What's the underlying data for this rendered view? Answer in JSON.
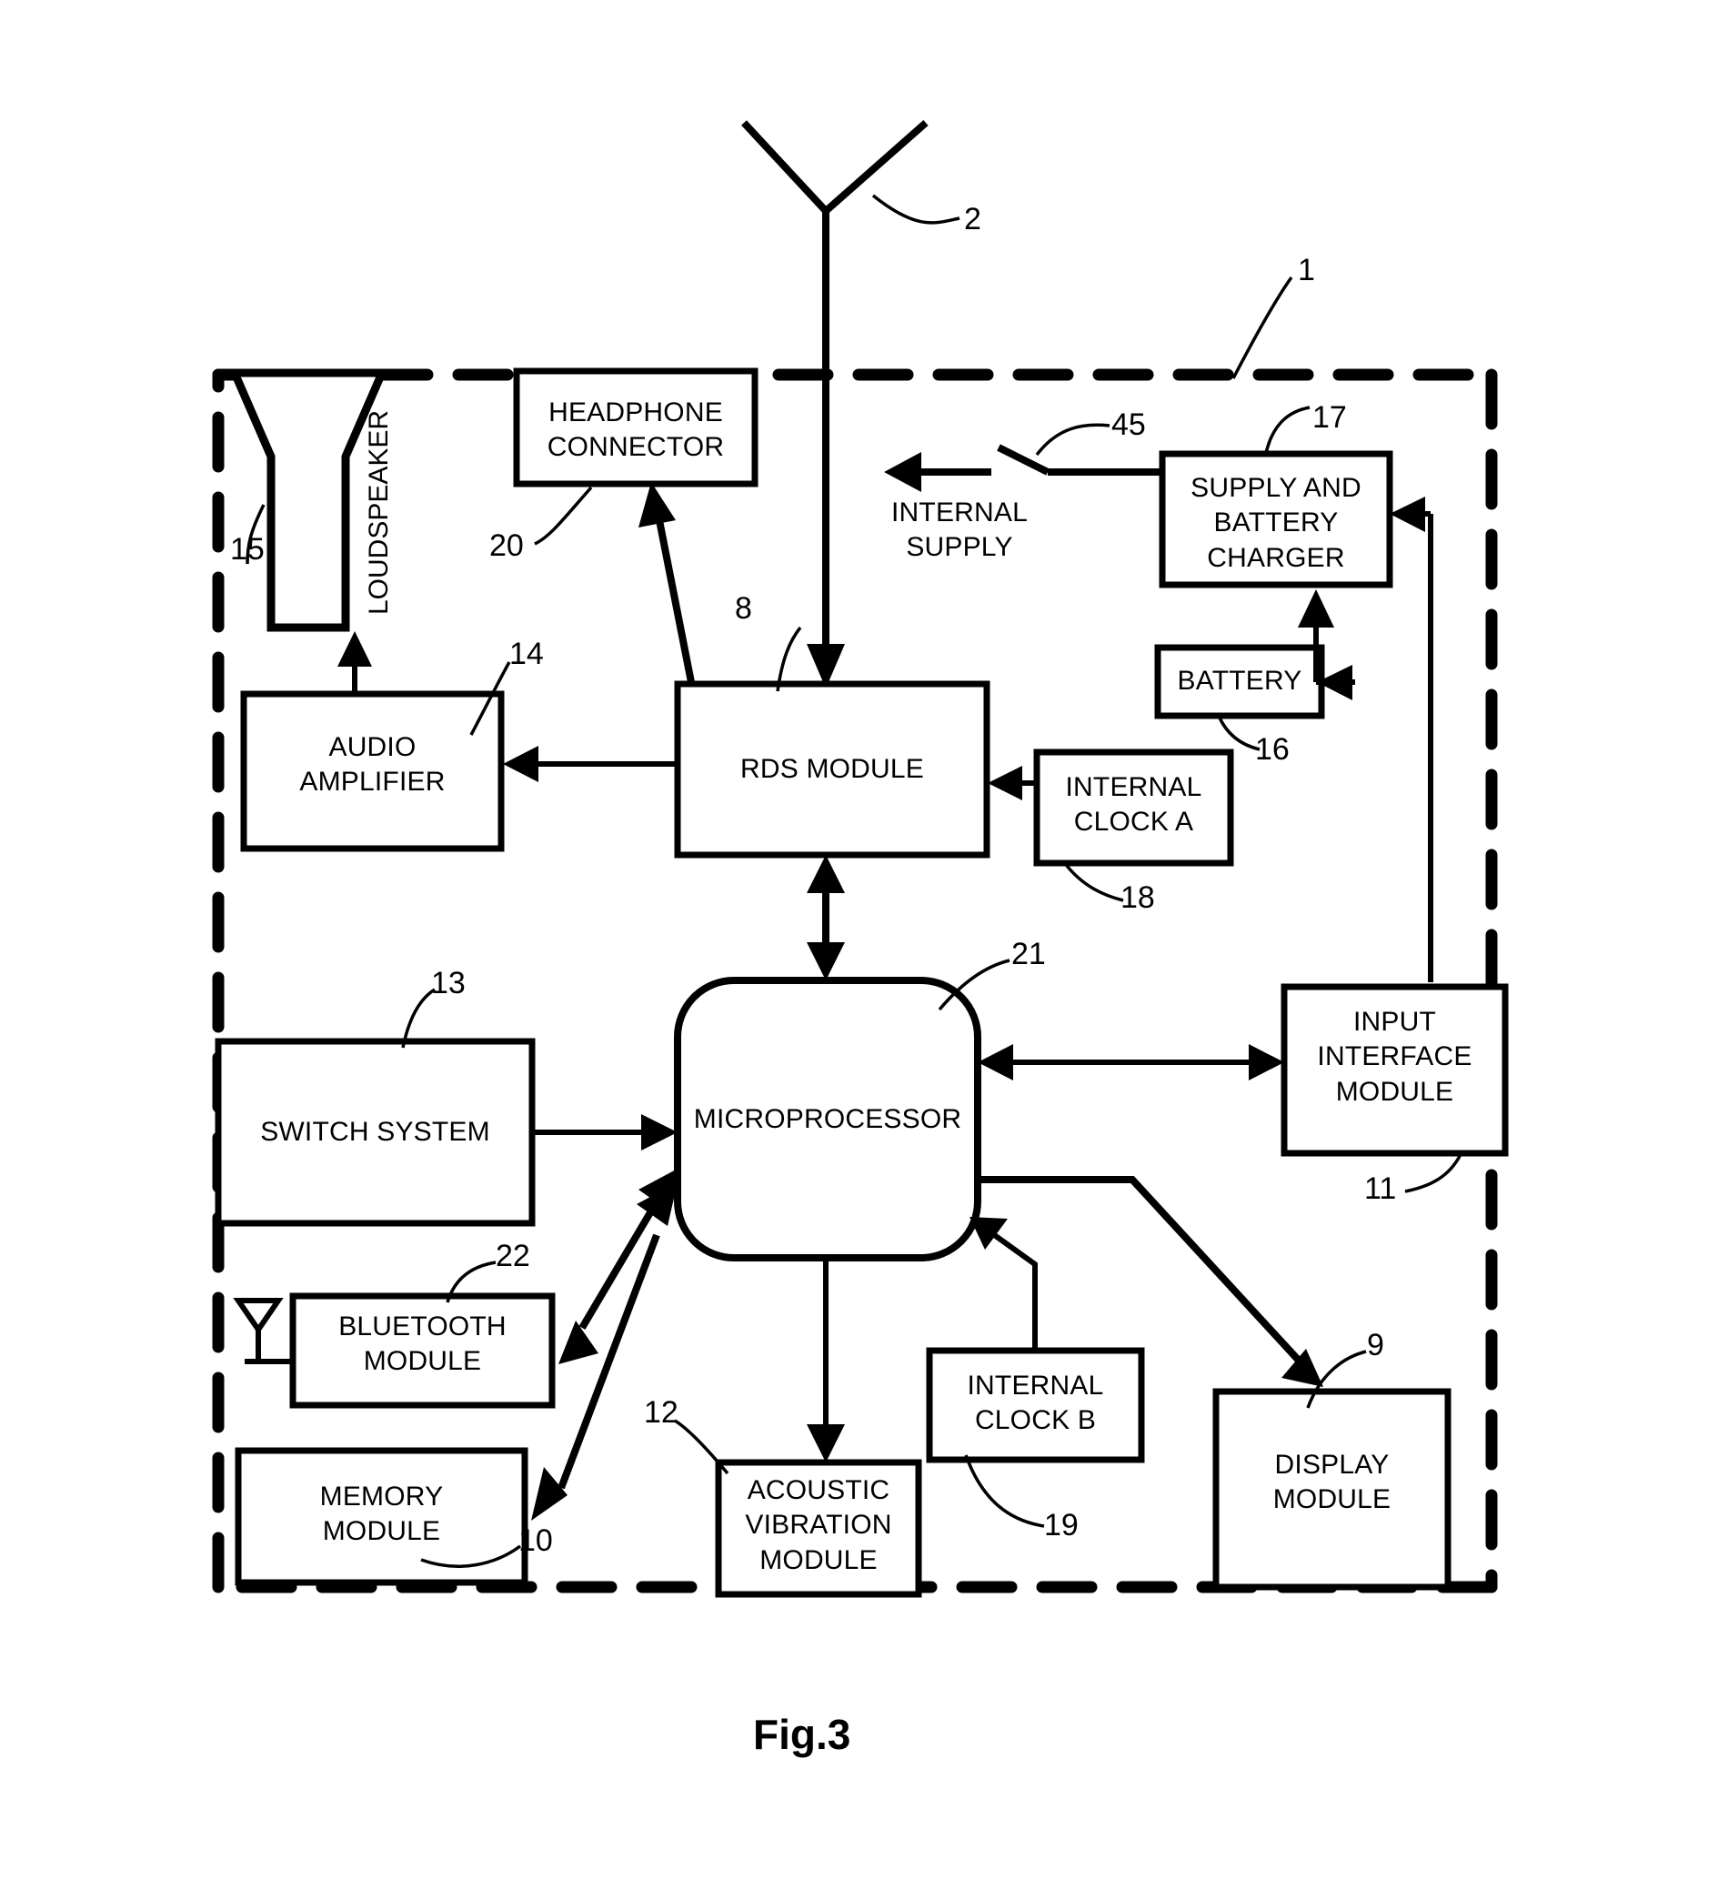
{
  "figure": {
    "caption": "Fig.3",
    "enclosure_ref": "1"
  },
  "blocks": [
    {
      "id": "antenna",
      "label": "",
      "ref": "2"
    },
    {
      "id": "loudspeaker",
      "label": "LOUDSPEAKER",
      "ref": "15"
    },
    {
      "id": "headphone",
      "label": "HEADPHONE\nCONNECTOR",
      "ref": "20"
    },
    {
      "id": "audio_amp",
      "label": "AUDIO\nAMPLIFIER",
      "ref": "14"
    },
    {
      "id": "rds",
      "label": "RDS MODULE",
      "ref": "8"
    },
    {
      "id": "clock_a",
      "label": "INTERNAL\nCLOCK A",
      "ref": "18"
    },
    {
      "id": "supply",
      "label": "SUPPLY AND\nBATTERY\nCHARGER",
      "ref": "17"
    },
    {
      "id": "battery",
      "label": "BATTERY",
      "ref": "16"
    },
    {
      "id": "switch45",
      "label": "",
      "ref": "45"
    },
    {
      "id": "internal_supply",
      "label": "INTERNAL\nSUPPLY",
      "ref": ""
    },
    {
      "id": "microprocessor",
      "label": "MICROPROCESSOR",
      "ref": "21"
    },
    {
      "id": "switch_system",
      "label": "SWITCH SYSTEM",
      "ref": "13"
    },
    {
      "id": "bluetooth",
      "label": "BLUETOOTH\nMODULE",
      "ref": "22"
    },
    {
      "id": "memory",
      "label": "MEMORY\nMODULE",
      "ref": "10"
    },
    {
      "id": "acoustic",
      "label": "ACOUSTIC\nVIBRATION\nMODULE",
      "ref": "12"
    },
    {
      "id": "clock_b",
      "label": "INTERNAL\nCLOCK B",
      "ref": "19"
    },
    {
      "id": "input_iface",
      "label": "INPUT\nINTERFACE\nMODULE",
      "ref": "11"
    },
    {
      "id": "display",
      "label": "DISPLAY\nMODULE",
      "ref": "9"
    }
  ],
  "colors": {
    "ink": "#000000",
    "paper": "#ffffff"
  }
}
